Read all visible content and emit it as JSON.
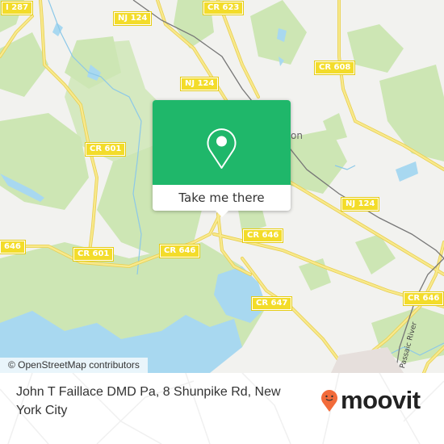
{
  "map": {
    "attribution": "© OpenStreetMap contributors",
    "town_label_fragment": "on",
    "river_label": "Passaic River",
    "road_shields": [
      {
        "label": "I 287"
      },
      {
        "label": "NJ 124"
      },
      {
        "label": "CR 623"
      },
      {
        "label": "NJ 124"
      },
      {
        "label": "CR 608"
      },
      {
        "label": "CR 601"
      },
      {
        "label": "NJ 124"
      },
      {
        "label": "CR 646"
      },
      {
        "label": "646"
      },
      {
        "label": "CR 601"
      },
      {
        "label": "CR 646"
      },
      {
        "label": "CR 647"
      },
      {
        "label": "CR 646"
      }
    ],
    "colors": {
      "land": "#f2f2ef",
      "wood": "#cde6b4",
      "water": "#a8d8f0",
      "road": "#f6e27a",
      "rail": "#777777"
    }
  },
  "popup": {
    "icon": "map-pin-icon",
    "button_label": "Take me there",
    "color": "#1fb76a"
  },
  "footer": {
    "address": "John T Faillace DMD Pa, 8 Shunpike Rd, New York City",
    "brand": "moovit",
    "brand_icon": "moovit-pin-logo-icon",
    "brand_color": "#f26b3a"
  }
}
